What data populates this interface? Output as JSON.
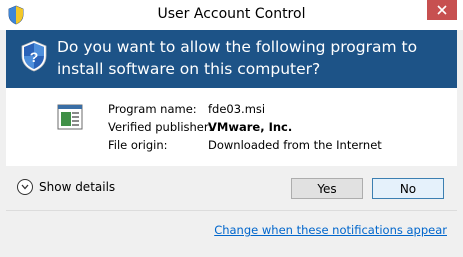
{
  "window": {
    "title": "User Account Control",
    "close_icon": "close-icon"
  },
  "banner": {
    "question": "Do you want to allow the following program to install software on this computer?",
    "color": "#1d5387"
  },
  "program_info": {
    "name_label": "Program name:",
    "name_value": "fde03.msi",
    "publisher_label": "Verified publisher:",
    "publisher_value": "VMware, Inc.",
    "origin_label": "File origin:",
    "origin_value": "Downloaded from the Internet"
  },
  "details": {
    "toggle_label": "Show details"
  },
  "buttons": {
    "yes_label": "Yes",
    "no_label": "No"
  },
  "footer": {
    "link_text": "Change when these notifications appear"
  },
  "colors": {
    "close_button": "#c75050",
    "link": "#0066cc"
  }
}
